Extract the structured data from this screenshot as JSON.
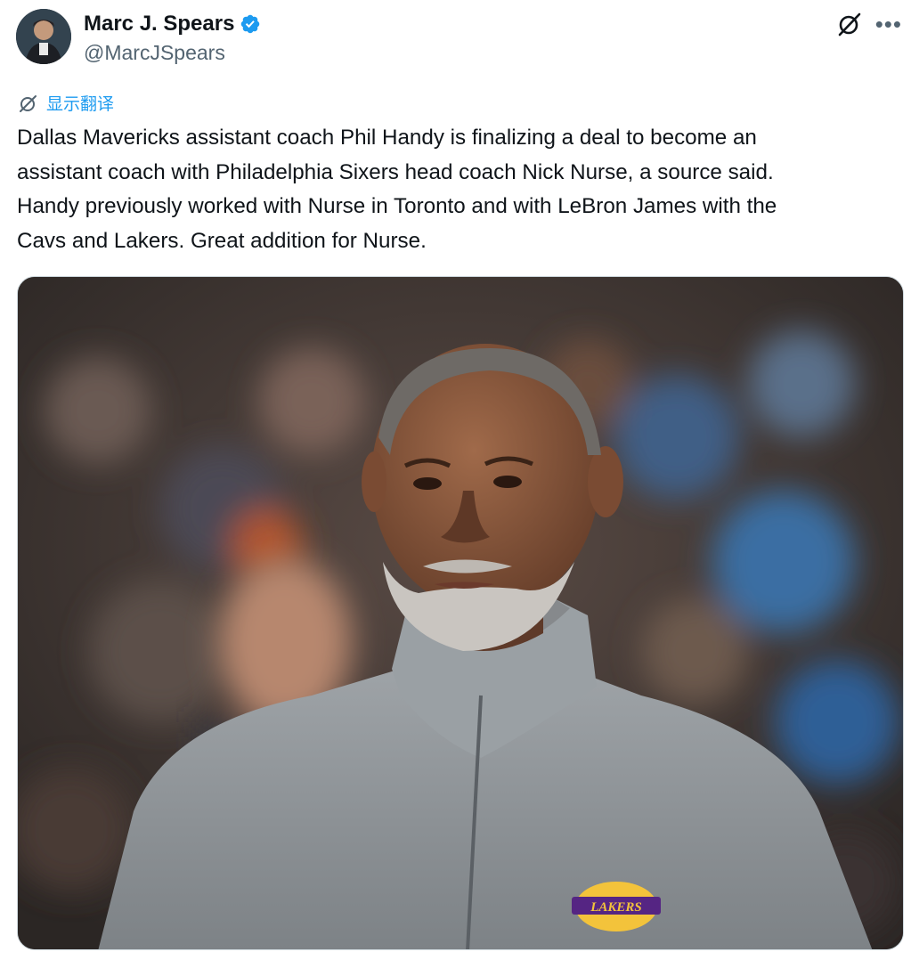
{
  "author": {
    "display_name": "Marc J. Spears",
    "handle": "@MarcJSpears",
    "verified": true
  },
  "translate_label": "显示翻译",
  "tweet_text": "Dallas Mavericks assistant coach Phil Handy is finalizing a deal to become an\nassistant coach with Philadelphia Sixers head coach Nick Nurse, a source said.\nHandy previously worked with Nurse in Toronto and with LeBron James with the\nCavs and Lakers. Great addition for Nurse.",
  "media": {
    "logo_text": "LAKERS"
  },
  "icons": {
    "verified": "verified-badge-icon",
    "grok": "grok-icon",
    "more": "more-icon",
    "translate": "translate-icon"
  },
  "colors": {
    "accent": "#1d9bf0",
    "secondary_text": "#536471"
  }
}
